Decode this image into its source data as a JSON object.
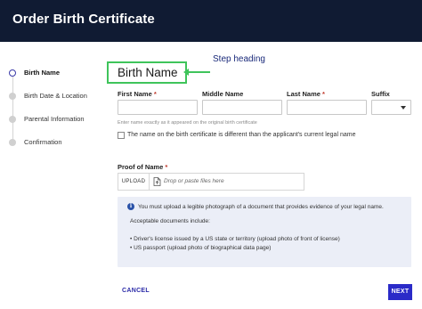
{
  "header": {
    "title": "Order Birth Certificate"
  },
  "stepper": {
    "items": [
      {
        "label": "Birth Name",
        "active": true
      },
      {
        "label": "Birth Date & Location",
        "active": false
      },
      {
        "label": "Parental Information",
        "active": false
      },
      {
        "label": "Confirmation",
        "active": false
      }
    ]
  },
  "form": {
    "heading": "Birth Name",
    "annotation": "Step heading",
    "first_name": {
      "label": "First Name",
      "required_mark": "*",
      "value": ""
    },
    "middle_name": {
      "label": "Middle Name",
      "value": ""
    },
    "last_name": {
      "label": "Last Name",
      "required_mark": "*",
      "value": ""
    },
    "suffix": {
      "label": "Suffix",
      "value": ""
    },
    "hint": "Enter name exactly as it appeared on the original birth certificate",
    "checkbox_label": "The name on the birth certificate is different than the applicant's current legal name",
    "checkbox_checked": false,
    "proof": {
      "label": "Proof of Name",
      "required_mark": "*",
      "upload_button": "UPLOAD",
      "placeholder": "Drop or paste files here"
    },
    "info": {
      "line1": "You must upload a legible photograph of a document that provides evidence of your legal name.",
      "line2": "Acceptable documents include:",
      "line3": "• Driver's license issued by a US state or territory (upload photo of front of license)",
      "line4": "• US passport (upload photo of biographical data page)"
    }
  },
  "footer": {
    "cancel_label": "CANCEL",
    "next_label": "NEXT"
  },
  "colors": {
    "header_bg": "#101b33",
    "accent": "#2b2bc8",
    "annotation": "#3fc45b",
    "required": "#c0392b",
    "info_bg": "#ebeef7"
  }
}
